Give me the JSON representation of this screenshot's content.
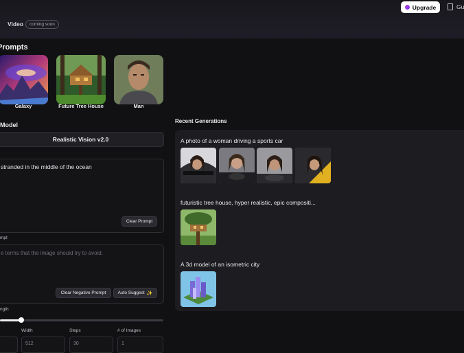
{
  "header": {
    "upgrade_label": "Upgrade",
    "guide_label": "Gui",
    "video_tab": "Video",
    "coming_soon_badge": "coming soon"
  },
  "prompts_section": {
    "title": "Prompts",
    "cards": [
      {
        "label": "Galaxy"
      },
      {
        "label": "Future Tree House"
      },
      {
        "label": "Man"
      }
    ]
  },
  "model": {
    "label": "Model",
    "selected": "Realistic Vision v2.0"
  },
  "prompt": {
    "value": "stranded in the middle of the ocean",
    "clear_label": "Clear Prompt"
  },
  "negative_prompt": {
    "label": "mpt",
    "placeholder": "e terms that the image should try to avoid.",
    "clear_label": "Clear Negative Prompt",
    "auto_suggest_label": "Auto Suggest"
  },
  "strength": {
    "label": "ngth",
    "value_fraction": 0.13
  },
  "params": {
    "width_label": "Width",
    "width_value": "512",
    "steps_label": "Steps",
    "steps_value": "30",
    "images_label": "# of Images",
    "images_value": "1"
  },
  "recent": {
    "title": "Recent Generations",
    "groups": [
      {
        "prompt": "A photo of a woman driving a sports car",
        "image_count": 4
      },
      {
        "prompt": "futuristic tree house, hyper realistic, epic compositi...",
        "image_count": 1
      },
      {
        "prompt": "A 3d model of an isometric city",
        "image_count": 1
      }
    ]
  },
  "colors": {
    "background": "#111113",
    "panel": "#1c1c21",
    "upgrade_gradient": [
      "#c13bd6",
      "#6c3df0"
    ]
  }
}
